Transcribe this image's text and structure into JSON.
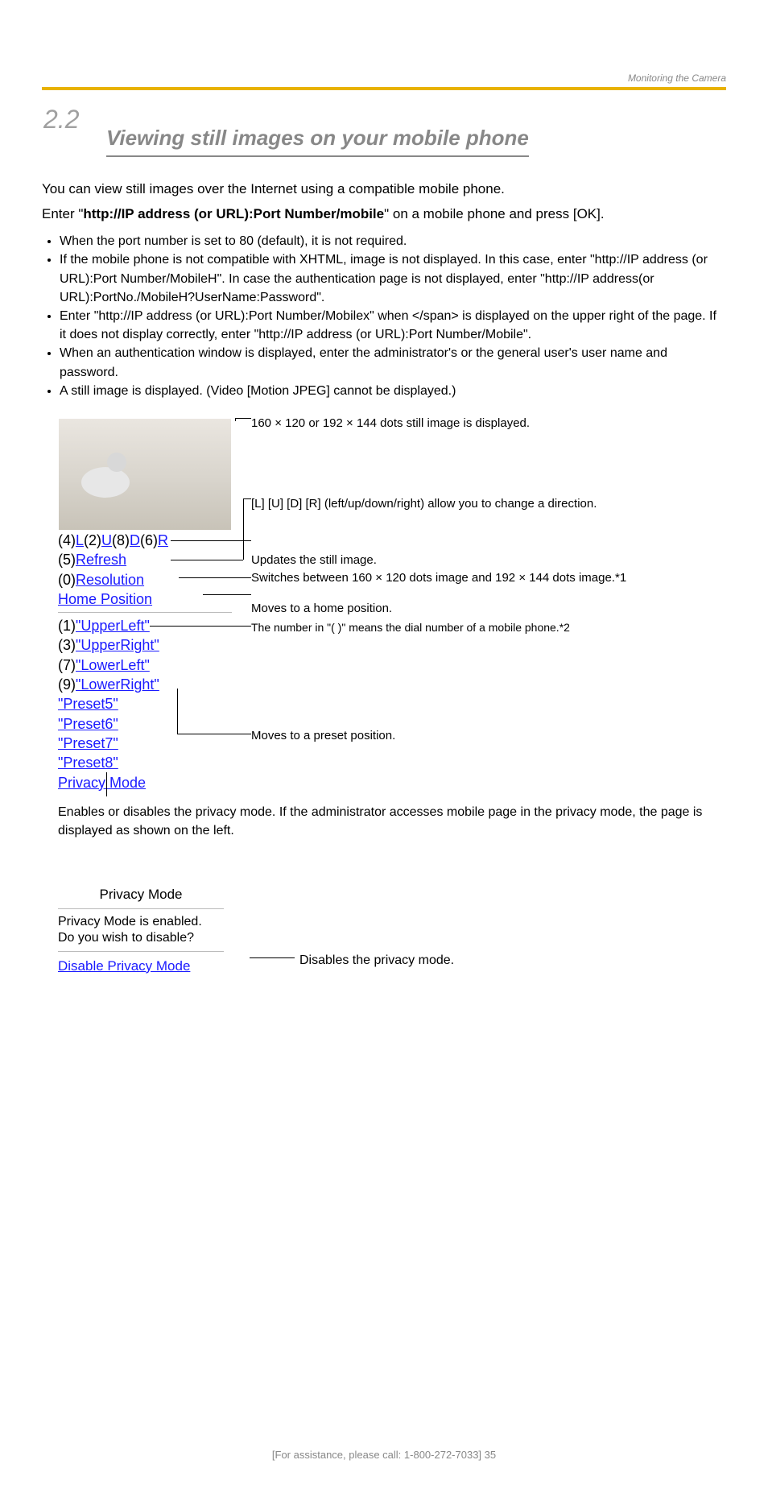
{
  "header": {
    "section_label_right": "Monitoring the Camera",
    "section_number": "2.2",
    "section_title": "Viewing still images on your mobile phone"
  },
  "intro": {
    "p1": "You can view still images over the Internet using a compatible mobile phone.",
    "p2_before": "Enter \"",
    "p2_url": "http://IP address (or URL):Port Number/mobile",
    "p2_after": "\" on a mobile phone and press [OK].",
    "bullets": [
      "When the port number is set to 80 (default), it is not required.",
      "If the mobile phone is not compatible with XHTML, image is not displayed. In this case, enter \"http://IP address (or URL):Port Number/MobileH\". In case the authentication page is not displayed, enter \"http://IP address(or URL):PortNo./MobileH?UserName:Password\".",
      "Enter \"http://IP address (or URL):Port Number/Mobilex\" when </span> is displayed on the upper right of the page. If it does not display correctly, enter \"http://IP address (or URL):Port Number/Mobile\".",
      "When an authentication window is displayed, enter the administrator's or the general user's user name and password.",
      "A still image is displayed. (Video [Motion JPEG] cannot be displayed.)"
    ]
  },
  "mockup": {
    "dir_row": {
      "p4": "(4)",
      "L": "L",
      "p2": "(2)",
      "U": "U",
      "p8": "(8)",
      "D": "D",
      "p6": "(6)",
      "R": "R"
    },
    "refresh": {
      "prefix": "(5)",
      "label": "Refresh"
    },
    "resolution": {
      "prefix": "(0)",
      "label": "Resolution"
    },
    "home": {
      "label": "Home Position"
    },
    "presets": [
      {
        "prefix": "(1)",
        "label": "\"UpperLeft\""
      },
      {
        "prefix": "(3)",
        "label": "\"UpperRight\""
      },
      {
        "prefix": "(7)",
        "label": "\"LowerLeft\""
      },
      {
        "prefix": "(9)",
        "label": "\"LowerRight\""
      },
      {
        "prefix": "",
        "label": "\"Preset5\""
      },
      {
        "prefix": "",
        "label": "\"Preset6\""
      },
      {
        "prefix": "",
        "label": "\"Preset7\""
      },
      {
        "prefix": "",
        "label": "\"Preset8\""
      }
    ],
    "privacy": {
      "label": "Privacy Mode"
    }
  },
  "callouts": {
    "image": "160 × 120 or 192 × 144 dots still image is displayed.",
    "dir": "[L] [U] [D] [R] (left/up/down/right) allow you to change a direction.",
    "refresh": "Updates the still image.",
    "resolution": "Switches between 160 × 120 dots image and 192 × 144 dots image.*1",
    "home": "Moves to a home position.",
    "preset_subnote": "The number in \"( )\" means the dial number of a mobile phone.*2",
    "preset": "Moves to a preset position.",
    "privacy_text": "Enables or disables the privacy mode. If the administrator accesses mobile page in the privacy mode, the page is displayed as shown on the left."
  },
  "privacy_box": {
    "title": "Privacy Mode",
    "line1": "Privacy Mode is enabled.",
    "line2": "Do you wish to disable?",
    "action": "Disable Privacy Mode"
  },
  "disable_callout": "Disables the privacy mode.",
  "footer": "[For assistance, please call: 1-800-272-7033]                 35"
}
